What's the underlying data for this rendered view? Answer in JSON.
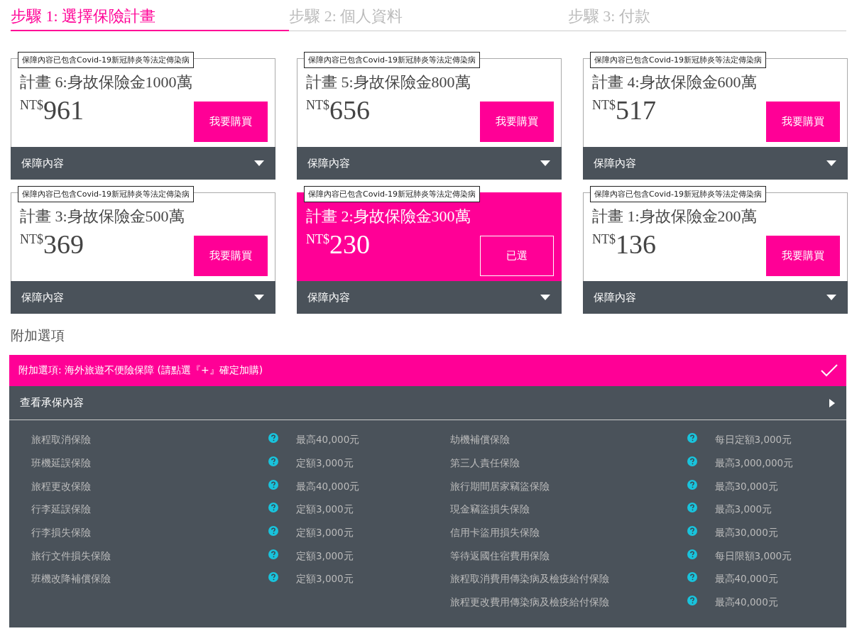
{
  "steps": [
    {
      "label": "步驟 1: 選擇保險計畫",
      "selected": true
    },
    {
      "label": "步驟 2: 個人資料",
      "selected": false
    },
    {
      "label": "步驟 3: 付款",
      "selected": false
    }
  ],
  "plans": [
    {
      "badge": "保障內容已包含Covid-19新冠肺炎等法定傳染病",
      "title": "計畫 6:身故保險金1000萬",
      "currency": "NT$",
      "price": "961",
      "button": "我要購買",
      "selected": false,
      "details": "保障內容"
    },
    {
      "badge": "保障內容已包含Covid-19新冠肺炎等法定傳染病",
      "title": "計畫 5:身故保險金800萬",
      "currency": "NT$",
      "price": "656",
      "button": "我要購買",
      "selected": false,
      "details": "保障內容"
    },
    {
      "badge": "保障內容已包含Covid-19新冠肺炎等法定傳染病",
      "title": "計畫 4:身故保險金600萬",
      "currency": "NT$",
      "price": "517",
      "button": "我要購買",
      "selected": false,
      "details": "保障內容"
    },
    {
      "badge": "保障內容已包含Covid-19新冠肺炎等法定傳染病",
      "title": "計畫 3:身故保險金500萬",
      "currency": "NT$",
      "price": "369",
      "button": "我要購買",
      "selected": false,
      "details": "保障內容"
    },
    {
      "badge": "保障內容已包含Covid-19新冠肺炎等法定傳染病",
      "title": "計畫 2:身故保險金300萬",
      "currency": "NT$",
      "price": "230",
      "button": "已選",
      "selected": true,
      "details": "保障內容"
    },
    {
      "badge": "保障內容已包含Covid-19新冠肺炎等法定傳染病",
      "title": "計畫 1:身故保險金200萬",
      "currency": "NT$",
      "price": "136",
      "button": "我要購買",
      "selected": false,
      "details": "保障內容"
    }
  ],
  "addon": {
    "heading": "附加選項",
    "title": "附加選項: 海外旅遊不便險保障 (請點選『+』確定加購)",
    "checked": true,
    "details_toggle": "查看承保內容",
    "coverage_columns": [
      [
        {
          "name": "旅程取消保險",
          "amount": "最高40,000元"
        },
        {
          "name": "班機延誤保險",
          "amount": "定額3,000元"
        },
        {
          "name": "旅程更改保險",
          "amount": "最高40,000元"
        },
        {
          "name": "行李延誤保險",
          "amount": "定額3,000元"
        },
        {
          "name": "行李損失保險",
          "amount": "定額3,000元"
        },
        {
          "name": "旅行文件損失保險",
          "amount": "定額3,000元"
        },
        {
          "name": "班機改降補償保險",
          "amount": "定額3,000元"
        }
      ],
      [
        {
          "name": "劫機補償保險",
          "amount": "每日定額3,000元"
        },
        {
          "name": "第三人責任保險",
          "amount": "最高3,000,000元"
        },
        {
          "name": "旅行期間居家竊盜保險",
          "amount": "最高30,000元"
        },
        {
          "name": "現金竊盜損失保險",
          "amount": "最高3,000元"
        },
        {
          "name": "信用卡盜用損失保險",
          "amount": "最高30,000元"
        },
        {
          "name": "等待返國住宿費用保險",
          "amount": "每日限額3,000元"
        },
        {
          "name": "旅程取消費用傳染病及檢疫給付保險",
          "amount": "最高40,000元"
        },
        {
          "name": "旅程更改費用傳染病及檢疫給付保險",
          "amount": "最高40,000元"
        }
      ]
    ]
  }
}
